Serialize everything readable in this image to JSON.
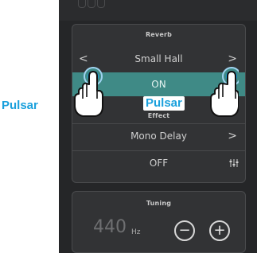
{
  "reverb": {
    "header": "Reverb",
    "type_value": "Small Hall",
    "state": "ON",
    "prev_symbol": "<",
    "next_symbol": ">"
  },
  "effect": {
    "header": "Effect",
    "type_value": "Mono Delay",
    "state": "OFF",
    "next_symbol": ">"
  },
  "tuning": {
    "header": "Tuning",
    "value": "440",
    "unit": "Hz",
    "decrease_symbol": "−",
    "increase_symbol": "+"
  },
  "annotations": {
    "tap_left": "Pulsar",
    "tap_right": "Pulsar"
  },
  "colors": {
    "accent_teal": "#3f8a86",
    "callout_blue": "#1aa0dc",
    "panel_bg": "#323335"
  },
  "icons": [
    "chevron-left-icon",
    "chevron-right-icon",
    "equalizer-icon",
    "minus-circle-icon",
    "plus-circle-icon",
    "hand-tap-icon"
  ]
}
